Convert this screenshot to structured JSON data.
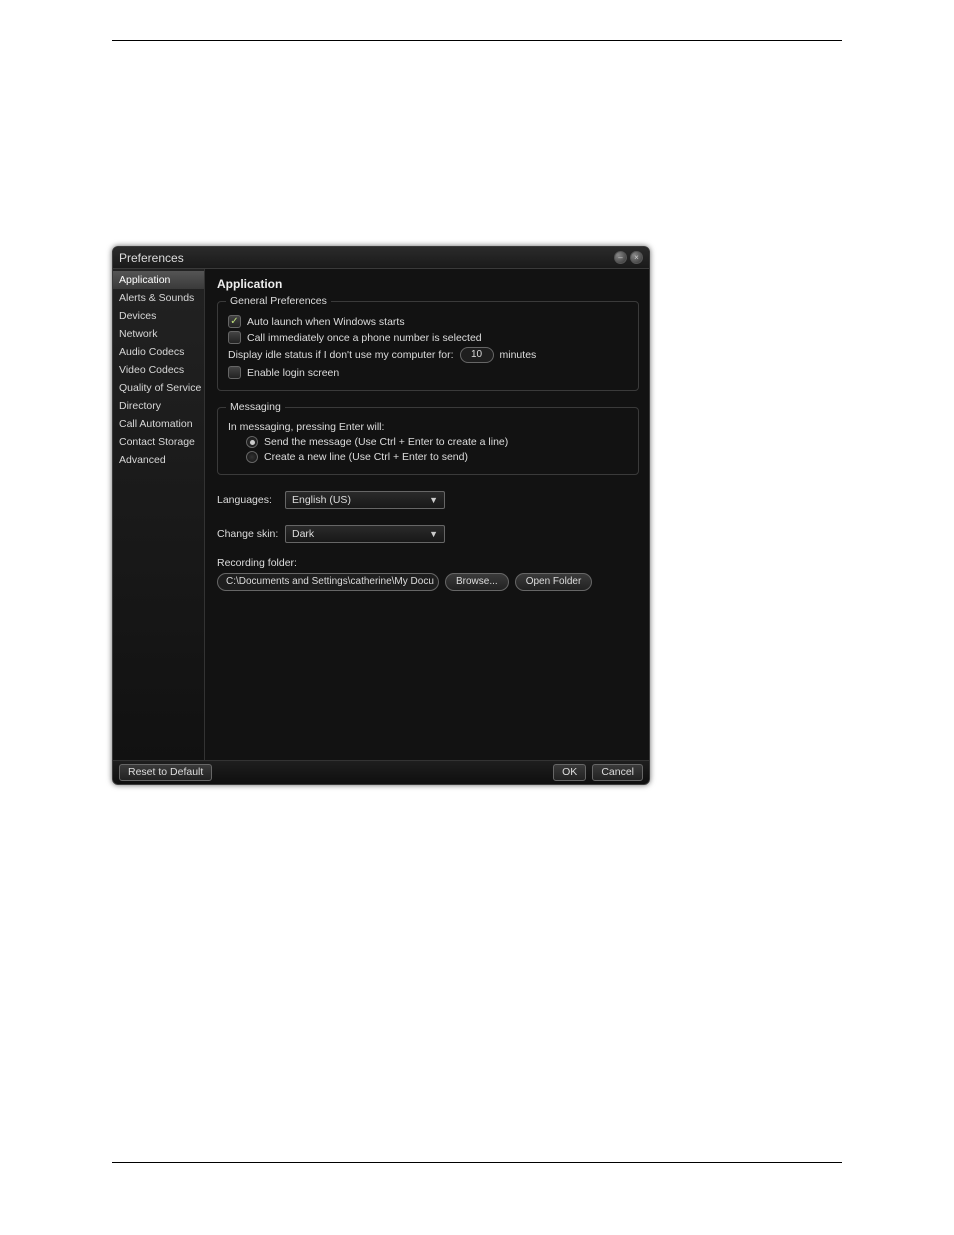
{
  "window": {
    "title": "Preferences"
  },
  "sidebar": {
    "items": [
      {
        "label": "Application",
        "selected": true
      },
      {
        "label": "Alerts & Sounds"
      },
      {
        "label": "Devices"
      },
      {
        "label": "Network"
      },
      {
        "label": "Audio Codecs"
      },
      {
        "label": "Video Codecs"
      },
      {
        "label": "Quality of Service"
      },
      {
        "label": "Directory"
      },
      {
        "label": "Call Automation"
      },
      {
        "label": "Contact Storage"
      },
      {
        "label": "Advanced"
      }
    ]
  },
  "content": {
    "title": "Application",
    "general": {
      "legend": "General Preferences",
      "auto_launch_label": "Auto launch when Windows starts",
      "auto_launch_checked": true,
      "call_immediately_label": "Call immediately once a phone number is selected",
      "call_immediately_checked": false,
      "idle_prefix": "Display idle status if I don't use my computer for:",
      "idle_value": "10",
      "idle_suffix": "minutes",
      "enable_login_label": "Enable login screen",
      "enable_login_checked": false
    },
    "messaging": {
      "legend": "Messaging",
      "prompt": "In messaging, pressing Enter will:",
      "option_send_label": "Send the message (Use Ctrl + Enter to create a line)",
      "option_newline_label": "Create a new line (Use Ctrl + Enter to send)",
      "selected": "send"
    },
    "languages": {
      "label": "Languages:",
      "value": "English (US)"
    },
    "skin": {
      "label": "Change skin:",
      "value": "Dark"
    },
    "recording": {
      "label": "Recording folder:",
      "path": "C:\\Documents and Settings\\catherine\\My Docu",
      "browse_label": "Browse...",
      "open_label": "Open Folder"
    }
  },
  "footer": {
    "reset_label": "Reset to Default",
    "ok_label": "OK",
    "cancel_label": "Cancel"
  }
}
